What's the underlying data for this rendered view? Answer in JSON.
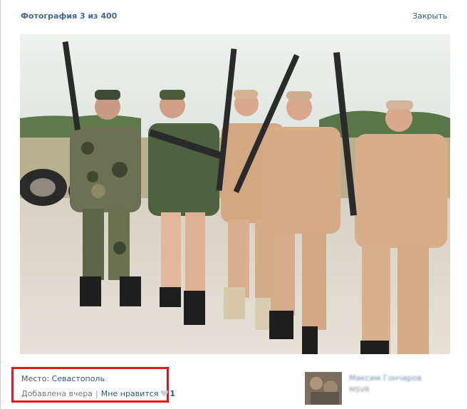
{
  "header": {
    "title": "Фотография 3 из 400",
    "close_label": "Закрыть"
  },
  "photo": {
    "description": ""
  },
  "info": {
    "place_label": "Место:",
    "place_value": "Севастополь",
    "added_label": "Добавлена вчера",
    "separator": "|",
    "like_label": "Мне нравится",
    "like_count": "1"
  },
  "author": {
    "name": "Максим Гончаров",
    "subtitle": "MSVR"
  },
  "colors": {
    "link": "#2b587a",
    "title": "#45688e",
    "highlight_border": "#e5171e"
  }
}
